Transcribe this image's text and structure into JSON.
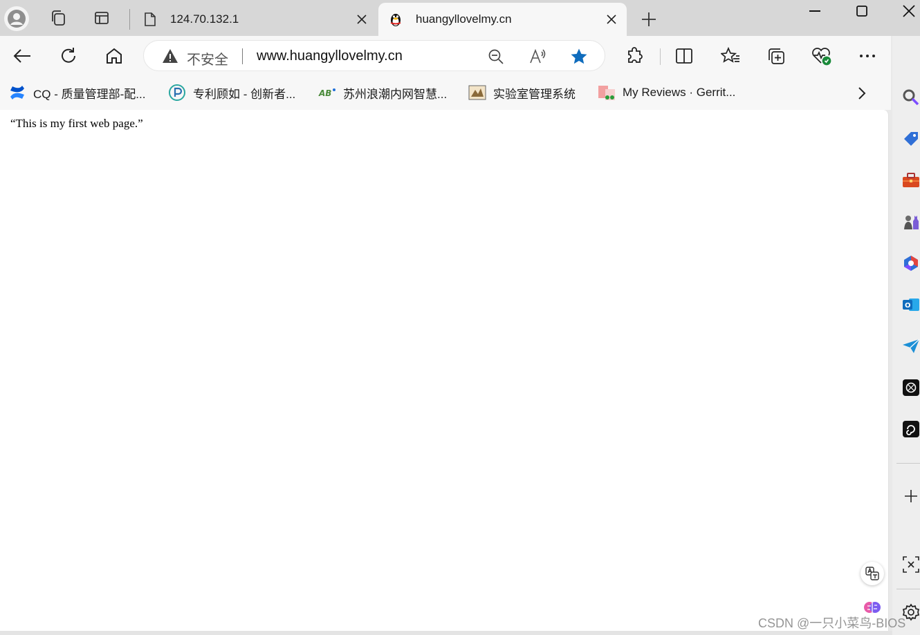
{
  "tabs": [
    {
      "title": "124.70.132.1",
      "favicon": "page-icon"
    },
    {
      "title": "huangyllovelmy.cn",
      "favicon": "qq-penguin-icon",
      "active": true
    }
  ],
  "address_bar": {
    "security_label": "不安全",
    "url": "www.huangyllovelmy.cn"
  },
  "favorites": [
    {
      "label": "CQ - 质量管理部-配...",
      "icon": "confluence-icon"
    },
    {
      "label": "专利顾如 - 创新者...",
      "icon": "patent-icon"
    },
    {
      "label": "苏州浪潮内网智慧...",
      "icon": "ab-icon"
    },
    {
      "label": "实验室管理系统",
      "icon": "lab-icon"
    },
    {
      "label": "My Reviews · Gerrit...",
      "icon": "gerrit-icon"
    }
  ],
  "page": {
    "text": "“This is my first web page.”"
  },
  "watermark": "CSDN @一只小菜鸟-BIOS",
  "colors": {
    "accent": "#0f6cbd",
    "tabbar_bg": "#d7d7d7",
    "toolbar_bg": "#f7f7f7"
  }
}
